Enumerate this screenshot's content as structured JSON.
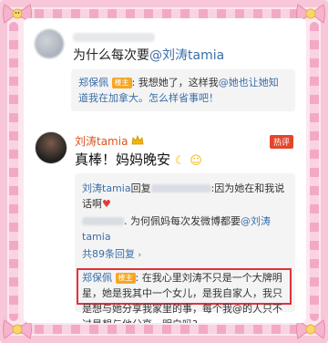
{
  "question": {
    "prefix": "为什么每次要",
    "mention": "@刘涛tamia"
  },
  "reply1": {
    "user": "郑保佩",
    "badge": "楼主",
    "text": ": 我想她了，这样我",
    "mention": "@她也让她知道",
    "text2": "我在加拿大。怎么样省事吧！"
  },
  "post": {
    "user": "刘涛tamia",
    "hot_label": "热评",
    "text": "真棒！妈妈晚安"
  },
  "thread": {
    "line1_user": "刘涛tamia",
    "line1_action": "回复",
    "line1_text": ":因为她在和我说话啊",
    "line2_text": ". 为何佩妈每次发微博都要",
    "line2_mention": "@刘涛tamia",
    "total_label": "共89条回复",
    "line3_user": "郑保佩",
    "line3_badge": "楼主",
    "line3_text": ": 在我心里刘涛不只是一个大牌明星，她是我其中一个女儿，是我自家人，我只是想与她分享我家里的事，每个我@的人只不过是想与他分享。明白吗?"
  },
  "colors": {
    "link": "#3b6ea8",
    "highlight_border": "#e0323a",
    "frame_pink": "#f3a9c6"
  }
}
